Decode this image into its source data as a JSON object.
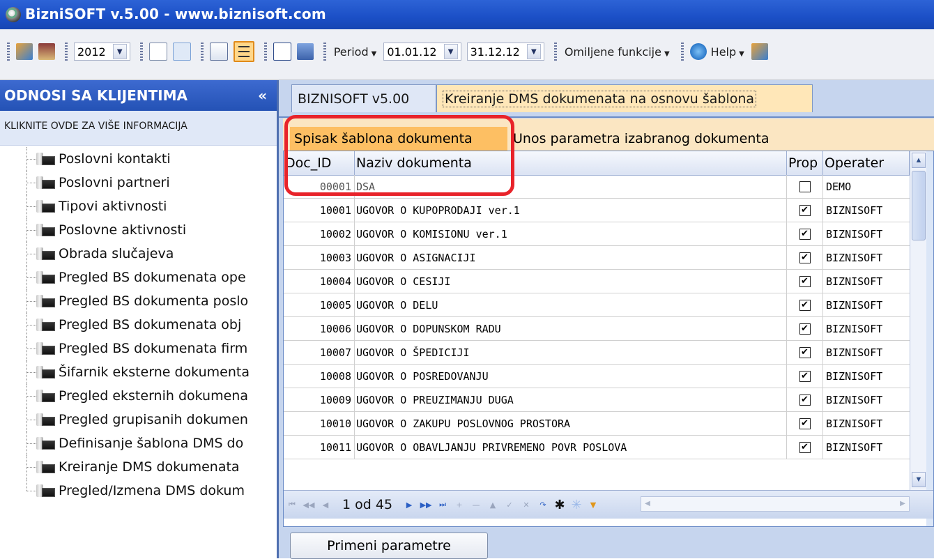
{
  "window": {
    "title": "BizniSOFT v.5.00 - www.biznisoft.com"
  },
  "toolbar": {
    "year": "2012",
    "period_label": "Period",
    "date_from": "01.01.12",
    "date_to": "31.12.12",
    "favorites_label": "Omiljene funkcije",
    "help_label": "Help"
  },
  "left_panel": {
    "header": "ODNOSI SA KLIJENTIMA",
    "collapse_glyph": "«",
    "info": "KLIKNITE OVDE ZA VIŠE INFORMACIJA",
    "items": [
      "Poslovni kontakti",
      "Poslovni partneri",
      "Tipovi aktivnosti",
      "Poslovne aktivnosti",
      "Obrada slučajeva",
      "Pregled BS dokumenata ope",
      "Pregled BS dokumenta poslo",
      "Pregled BS dokumenata obj",
      "Pregled BS dokumenata firm",
      "Šifarnik eksterne dokumenta",
      "Pregled eksternih dokumena",
      "Pregled grupisanih dokumen",
      "Definisanje šablona DMS do",
      "Kreiranje DMS dokumenata",
      "Pregled/Izmena DMS dokum"
    ]
  },
  "main": {
    "tabs": [
      "BIZNISOFT v5.00",
      "Kreiranje DMS dokumenata na osnovu šablona"
    ],
    "subtabs": [
      "Spisak šablona dokumenta",
      "Unos parametra izabranog dokumenta"
    ],
    "columns": [
      "Doc_ID",
      "Naziv dokumenta",
      "Prop",
      "Operater"
    ],
    "rows": [
      {
        "id": "00001",
        "name": "DSA",
        "checked": "",
        "operator": "DEMO"
      },
      {
        "id": "10001",
        "name": "UGOVOR O KUPOPRODAJI ver.1",
        "checked": "✔",
        "operator": "BIZNISOFT"
      },
      {
        "id": "10002",
        "name": "UGOVOR O KOMISIONU ver.1",
        "checked": "✔",
        "operator": "BIZNISOFT"
      },
      {
        "id": "10003",
        "name": "UGOVOR O ASIGNACIJI",
        "checked": "✔",
        "operator": "BIZNISOFT"
      },
      {
        "id": "10004",
        "name": "UGOVOR O CESIJI",
        "checked": "✔",
        "operator": "BIZNISOFT"
      },
      {
        "id": "10005",
        "name": "UGOVOR O DELU",
        "checked": "✔",
        "operator": "BIZNISOFT"
      },
      {
        "id": "10006",
        "name": "UGOVOR O DOPUNSKOM RADU",
        "checked": "✔",
        "operator": "BIZNISOFT"
      },
      {
        "id": "10007",
        "name": "UGOVOR O ŠPEDICIJI",
        "checked": "✔",
        "operator": "BIZNISOFT"
      },
      {
        "id": "10008",
        "name": "UGOVOR O POSREDOVANJU",
        "checked": "✔",
        "operator": "BIZNISOFT"
      },
      {
        "id": "10009",
        "name": "UGOVOR O PREUZIMANJU DUGA",
        "checked": "✔",
        "operator": "BIZNISOFT"
      },
      {
        "id": "10010",
        "name": "UGOVOR O ZAKUPU POSLOVNOG PROSTORA",
        "checked": "✔",
        "operator": "BIZNISOFT"
      },
      {
        "id": "10011",
        "name": "UGOVOR O OBAVLJANJU PRIVREMENO POVR POSLOVA",
        "checked": "✔",
        "operator": "BIZNISOFT"
      }
    ],
    "pager": "1 od 45",
    "apply_button": "Primeni parametre"
  },
  "colors": {
    "title_bar": "#1b4fc6",
    "active_tab": "#fdbf63",
    "highlight_annotation": "#e8232a"
  }
}
